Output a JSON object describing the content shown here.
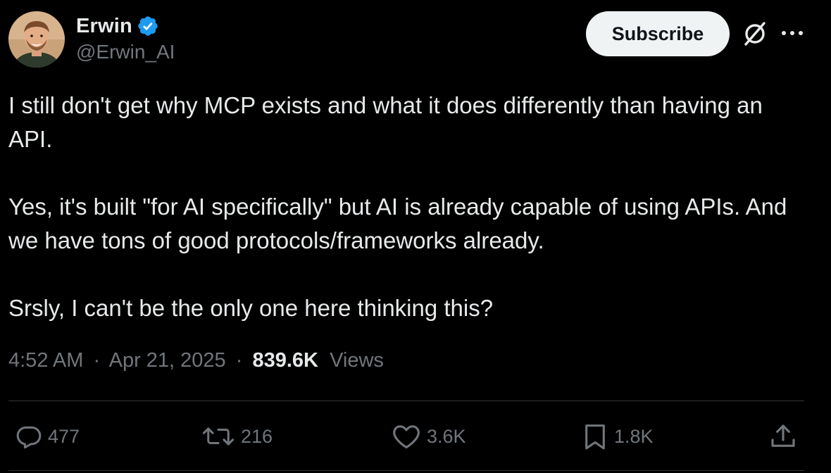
{
  "author": {
    "display_name": "Erwin",
    "handle": "@Erwin_AI",
    "verified": true
  },
  "header": {
    "subscribe_label": "Subscribe",
    "grok_icon": "grok-icon",
    "more_icon": "more-icon"
  },
  "tweet": {
    "paragraphs": [
      "I still don't get why MCP exists and what it does differently than having an API.",
      "Yes, it's built \"for AI specifically\" but AI is already capable of using APIs. And we have tons of good protocols/frameworks already.",
      "Srsly, I can't be the only one here thinking this?"
    ]
  },
  "meta": {
    "time": "4:52 AM",
    "separator": "·",
    "date": "Apr 21, 2025",
    "views_count": "839.6K",
    "views_label": "Views"
  },
  "actions": {
    "replies": "477",
    "reposts": "216",
    "likes": "3.6K",
    "bookmarks": "1.8K"
  },
  "colors": {
    "background": "#000000",
    "text": "#e7e9ea",
    "muted": "#71767b",
    "verified": "#1d9bf0",
    "button_bg": "#eff3f4",
    "divider": "#2f3336"
  }
}
